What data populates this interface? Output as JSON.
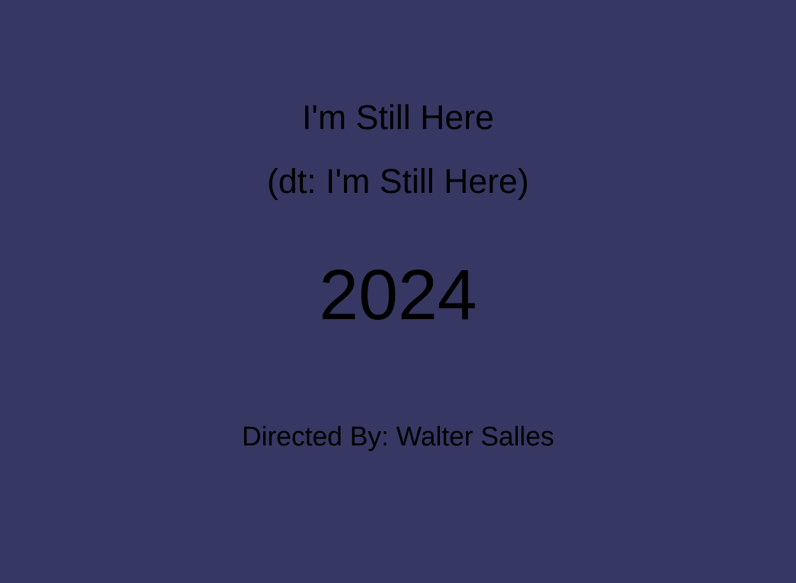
{
  "movie": {
    "title": "I'm Still Here",
    "alt_title": "(dt: I'm Still Here)",
    "year": "2024",
    "director_line": "Directed By: Walter Salles"
  },
  "colors": {
    "background": "#363762",
    "text": "#000000"
  }
}
